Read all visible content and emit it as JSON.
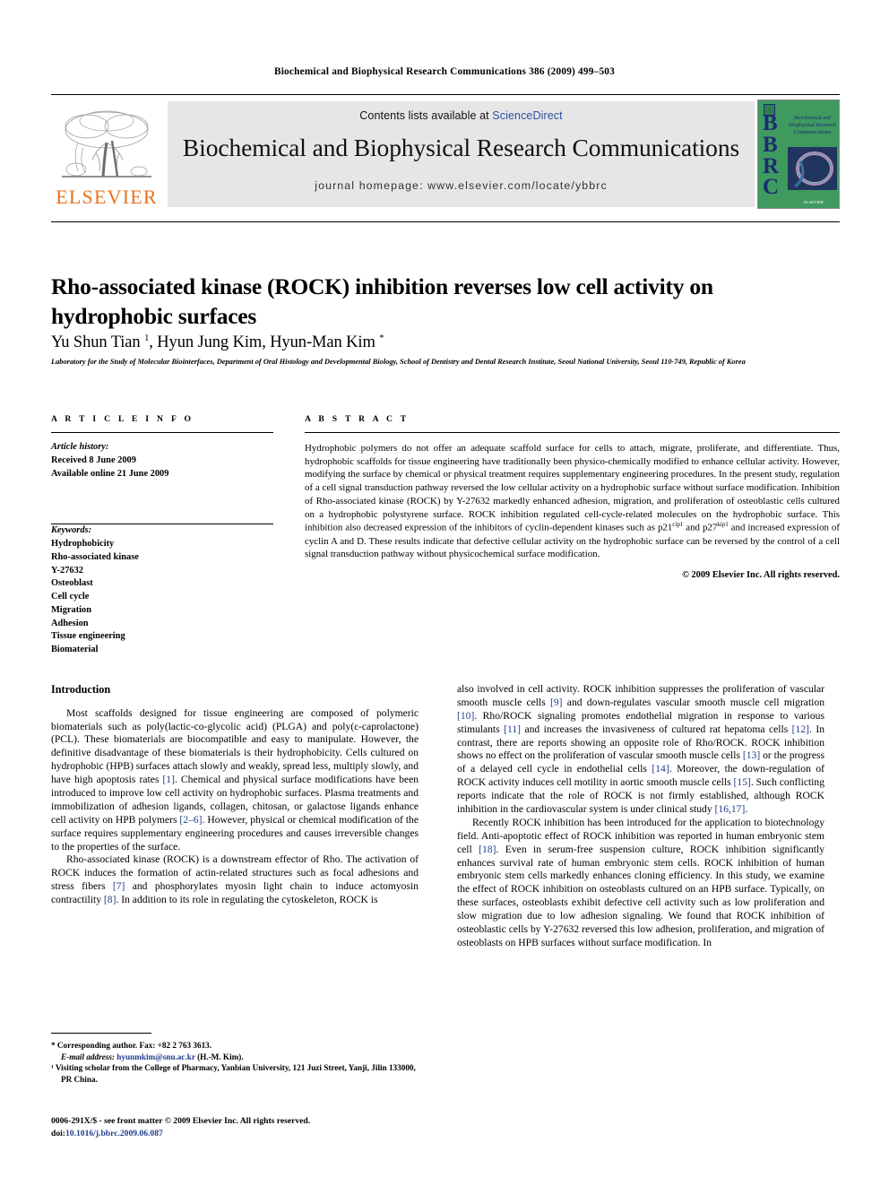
{
  "running_head": "Biochemical and Biophysical Research Communications 386 (2009) 499–503",
  "masthead": {
    "contents_prefix": "Contents lists available at ",
    "sciencedirect": "ScienceDirect",
    "journal_title": "Biochemical and Biophysical Research Communications",
    "homepage": "journal homepage: www.elsevier.com/locate/ybbrc",
    "publisher_name": "ELSEVIER",
    "cover_letters": "BBRC",
    "cover_title": "Biochemical and Biophysical Research Communications",
    "cover_publisher": "ELSEVIER",
    "colors": {
      "elsevier_orange": "#E9711C",
      "link_blue": "#2b4f9e",
      "band_gray": "#e6e6e6",
      "cover_green": "#3f9a60",
      "cover_letter_blue": "#1b2c72"
    }
  },
  "article": {
    "title": "Rho-associated kinase (ROCK) inhibition reverses low cell activity on hydrophobic surfaces",
    "authors": "Yu Shun Tian ¹, Hyun Jung Kim, Hyun-Man Kim *",
    "affiliation": "Laboratory for the Study of Molecular Biointerfaces, Department of Oral Histology and Developmental Biology, School of Dentistry and Dental Research Institute, Seoul National University, Seoul 110-749, Republic of Korea"
  },
  "article_info": {
    "heading": "A R T I C L E  I N F O",
    "history_label": "Article history:",
    "history": [
      "Received 8 June 2009",
      "Available online 21 June 2009"
    ],
    "keywords_label": "Keywords:",
    "keywords": [
      "Hydrophobicity",
      "Rho-associated kinase",
      "Y-27632",
      "Osteoblast",
      "Cell cycle",
      "Migration",
      "Adhesion",
      "Tissue engineering",
      "Biomaterial"
    ]
  },
  "abstract": {
    "heading": "A B S T R A C T",
    "text": "Hydrophobic polymers do not offer an adequate scaffold surface for cells to attach, migrate, proliferate, and differentiate. Thus, hydrophobic scaffolds for tissue engineering have traditionally been physico-chemically modified to enhance cellular activity. However, modifying the surface by chemical or physical treatment requires supplementary engineering procedures. In the present study, regulation of a cell signal transduction pathway reversed the low cellular activity on a hydrophobic surface without surface modification. Inhibition of Rho-associated kinase (ROCK) by Y-27632 markedly enhanced adhesion, migration, and proliferation of osteoblastic cells cultured on a hydrophobic polystyrene surface. ROCK inhibition regulated cell-cycle-related molecules on the hydrophobic surface. This inhibition also decreased expression of the inhibitors of cyclin-dependent kinases such as p21",
    "sup1": "cip1",
    "text2": " and p27",
    "sup2": "kip1",
    "text3": " and increased expression of cyclin A and D. These results indicate that defective cellular activity on the hydrophobic surface can be reversed by the control of a cell signal transduction pathway without physicochemical surface modification.",
    "copyright": "© 2009 Elsevier Inc. All rights reserved."
  },
  "introduction": {
    "heading": "Introduction",
    "left_paragraphs": [
      "Most scaffolds designed for tissue engineering are composed of polymeric biomaterials such as poly(lactic-co-glycolic acid) (PLGA) and poly(ε-caprolactone) (PCL). These biomaterials are biocompatible and easy to manipulate. However, the definitive disadvantage of these biomaterials is their hydrophobicity. Cells cultured on hydrophobic (HPB) surfaces attach slowly and weakly, spread less, multiply slowly, and have high apoptosis rates [1]. Chemical and physical surface modifications have been introduced to improve low cell activity on hydrophobic surfaces. Plasma treatments and immobilization of adhesion ligands, collagen, chitosan, or galactose ligands enhance cell activity on HPB polymers [2–6]. However, physical or chemical modification of the surface requires supplementary engineering procedures and causes irreversible changes to the properties of the surface.",
      "Rho-associated kinase (ROCK) is a downstream effector of Rho. The activation of ROCK induces the formation of actin-related structures such as focal adhesions and stress fibers [7] and phosphorylates myosin light chain to induce actomyosin contractility [8]. In addition to its role in regulating the cytoskeleton, ROCK is"
    ],
    "right_paragraphs": [
      "also involved in cell activity. ROCK inhibition suppresses the proliferation of vascular smooth muscle cells [9] and down-regulates vascular smooth muscle cell migration [10]. Rho/ROCK signaling promotes endothelial migration in response to various stimulants [11] and increases the invasiveness of cultured rat hepatoma cells [12]. In contrast, there are reports showing an opposite role of Rho/ROCK. ROCK inhibition shows no effect on the proliferation of vascular smooth muscle cells [13] or the progress of a delayed cell cycle in endothelial cells [14]. Moreover, the down-regulation of ROCK activity induces cell motility in aortic smooth muscle cells [15]. Such conflicting reports indicate that the role of ROCK is not firmly established, although ROCK inhibition in the cardiovascular system is under clinical study [16,17].",
      "Recently ROCK inhibition has been introduced for the application to biotechnology field. Anti-apoptotic effect of ROCK inhibition was reported in human embryonic stem cell [18]. Even in serum-free suspension culture, ROCK inhibition significantly enhances survival rate of human embryonic stem cells. ROCK inhibition of human embryonic stem cells markedly enhances cloning efficiency. In this study, we examine the effect of ROCK inhibition on osteoblasts cultured on an HPB surface. Typically, on these surfaces, osteoblasts exhibit defective cell activity such as low proliferation and slow migration due to low adhesion signaling. We found that ROCK inhibition of osteoblastic cells by Y-27632 reversed this low adhesion, proliferation, and migration of osteoblasts on HPB surfaces without surface modification. In"
    ]
  },
  "footnotes": {
    "corresponding": "* Corresponding author. Fax: +82 2 763 3613.",
    "email_label": "E-mail address:",
    "email": "hyunmkim@snu.ac.kr",
    "email_suffix": " (H.-M. Kim).",
    "note1": "¹ Visiting scholar from the College of Pharmacy, Yanbian University, 121 Juzi Street, Yanji, Jilin 133000, PR China."
  },
  "footer": {
    "issn_line": "0006-291X/$ - see front matter © 2009 Elsevier Inc. All rights reserved.",
    "doi_label": "doi:",
    "doi_value": "10.1016/j.bbrc.2009.06.087"
  }
}
